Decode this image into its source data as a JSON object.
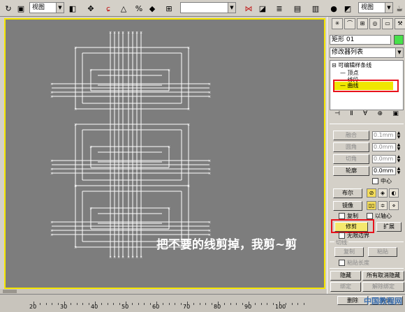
{
  "toolbar": {
    "view_label_left": "视图",
    "view_label_right": "视图"
  },
  "caption": "把不要的线剪掉，我剪~剪",
  "panel": {
    "object_name": "矩形 01",
    "modifier_list": "修改器列表",
    "stack": [
      {
        "label": "可编辑样条线"
      },
      {
        "label": "顶点"
      },
      {
        "label": "线段"
      },
      {
        "label": "曲线"
      }
    ],
    "buttons": {
      "fuse": "融合",
      "fillet": "圆角",
      "chamfer": "切角",
      "outline": "轮廓",
      "boolean": "布尔",
      "mirror": "镜像",
      "trim": "修剪",
      "extend": "扩展",
      "copy": "复制",
      "paste": "粘贴",
      "hide": "隐藏",
      "unhide_all": "所有取消隐藏",
      "bind": "绑定",
      "unbind": "解除绑定",
      "delete": "删除",
      "close": "关闭"
    },
    "spinners": {
      "fuse_value": "0.1mm",
      "fillet_value": "0.0mm",
      "chamfer_value": "0.0mm",
      "outline_value": "0.0mm"
    },
    "checks": {
      "center": "中心",
      "copy": "复制",
      "about_axis": "以轴心",
      "infinite_bounds": "无限边界",
      "paste_length": "粘贴长度"
    },
    "group_title": "切线"
  },
  "timeline": {
    "ticks": [
      "20",
      "30",
      "40",
      "50",
      "60",
      "70",
      "80",
      "90",
      "100"
    ]
  },
  "watermark": "中国教程网"
}
